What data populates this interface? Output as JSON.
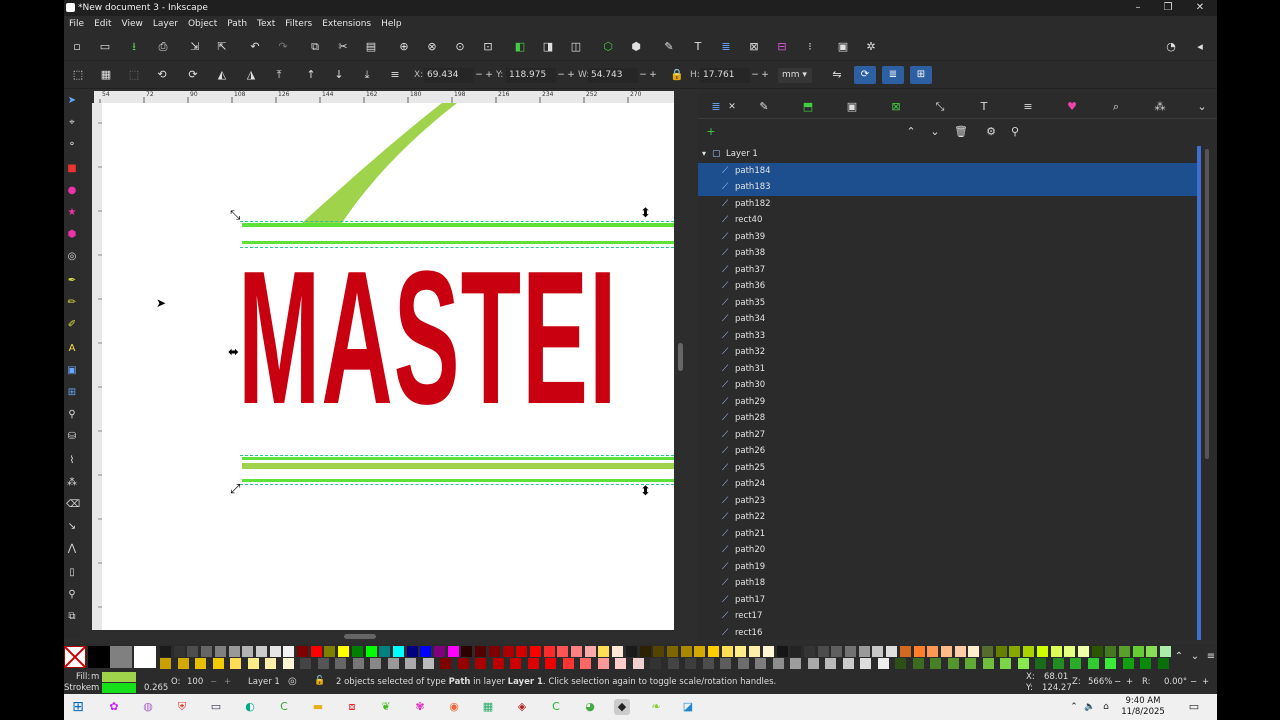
{
  "window": {
    "title": "*New document 3 - Inkscape",
    "min_label": "–",
    "max_label": "❐",
    "close_label": "✕"
  },
  "menu": [
    "File",
    "Edit",
    "View",
    "Layer",
    "Object",
    "Path",
    "Text",
    "Filters",
    "Extensions",
    "Help"
  ],
  "controls": {
    "x_label": "X:",
    "x": "69.434",
    "y_label": "Y:",
    "y": "118.975",
    "w_label": "W:",
    "w": "54.743",
    "h_label": "H:",
    "h": "17.761",
    "unit": "mm"
  },
  "canvas": {
    "text": "MASTEI",
    "ruler_labels": [
      "54",
      "72",
      "90",
      "108",
      "126",
      "144",
      "162",
      "180",
      "198",
      "216",
      "234",
      "252",
      "270"
    ],
    "accent_green": "#9fd34b",
    "text_red": "#c8000f"
  },
  "objects": {
    "layer_name": "Layer 1",
    "items": [
      {
        "name": "path184",
        "selected": true
      },
      {
        "name": "path183",
        "selected": true
      },
      {
        "name": "path182",
        "selected": false
      },
      {
        "name": "rect40",
        "selected": false
      },
      {
        "name": "path39",
        "selected": false
      },
      {
        "name": "path38",
        "selected": false
      },
      {
        "name": "path37",
        "selected": false
      },
      {
        "name": "path36",
        "selected": false
      },
      {
        "name": "path35",
        "selected": false
      },
      {
        "name": "path34",
        "selected": false
      },
      {
        "name": "path33",
        "selected": false
      },
      {
        "name": "path32",
        "selected": false
      },
      {
        "name": "path31",
        "selected": false
      },
      {
        "name": "path30",
        "selected": false
      },
      {
        "name": "path29",
        "selected": false
      },
      {
        "name": "path28",
        "selected": false
      },
      {
        "name": "path27",
        "selected": false
      },
      {
        "name": "path26",
        "selected": false
      },
      {
        "name": "path25",
        "selected": false
      },
      {
        "name": "path24",
        "selected": false
      },
      {
        "name": "path23",
        "selected": false
      },
      {
        "name": "path22",
        "selected": false
      },
      {
        "name": "path21",
        "selected": false
      },
      {
        "name": "path20",
        "selected": false
      },
      {
        "name": "path19",
        "selected": false
      },
      {
        "name": "path18",
        "selected": false
      },
      {
        "name": "path17",
        "selected": false
      },
      {
        "name": "rect17",
        "selected": false
      },
      {
        "name": "rect16",
        "selected": false
      }
    ]
  },
  "status": {
    "fill_label": "Fill:",
    "fill_val": "m",
    "stroke_label": "Stroke:",
    "stroke_val": "m",
    "stroke_width": "0.265",
    "opacity_label": "O:",
    "opacity": "100",
    "layer": "Layer 1",
    "message_prefix": "2 objects selected of type ",
    "message_type": "Path",
    "message_mid": " in layer ",
    "message_layer": "Layer 1",
    "message_suffix": ". Click selection again to toggle scale/rotation handles.",
    "cursor_x_label": "X:",
    "cursor_x": "68.01",
    "cursor_y_label": "Y:",
    "cursor_y": "124.27",
    "zoom_label": "Z:",
    "zoom": "566%",
    "rotation_label": "R:",
    "rotation": "0.00°"
  },
  "taskbar": {
    "time": "9:40 AM",
    "date": "11/8/2025"
  }
}
